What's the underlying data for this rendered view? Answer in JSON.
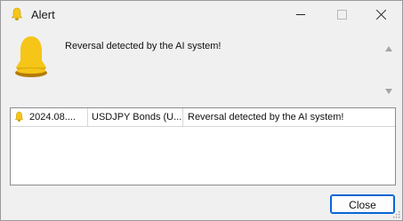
{
  "window": {
    "title": "Alert",
    "icon": "bell-icon"
  },
  "alert": {
    "message": "Reversal detected by the AI system!",
    "icon": "bell-icon"
  },
  "list": {
    "rows": [
      {
        "icon": "bell-icon",
        "time": "2024.08....",
        "symbol": "USDJPY Bonds (U...",
        "message": "Reversal detected by the AI system!"
      }
    ]
  },
  "buttons": {
    "close_label": "Close"
  },
  "colors": {
    "bell": "#f5c518",
    "bell_dark": "#b8860b",
    "accent": "#0a64d6",
    "window_bg": "#f0f0f0"
  }
}
